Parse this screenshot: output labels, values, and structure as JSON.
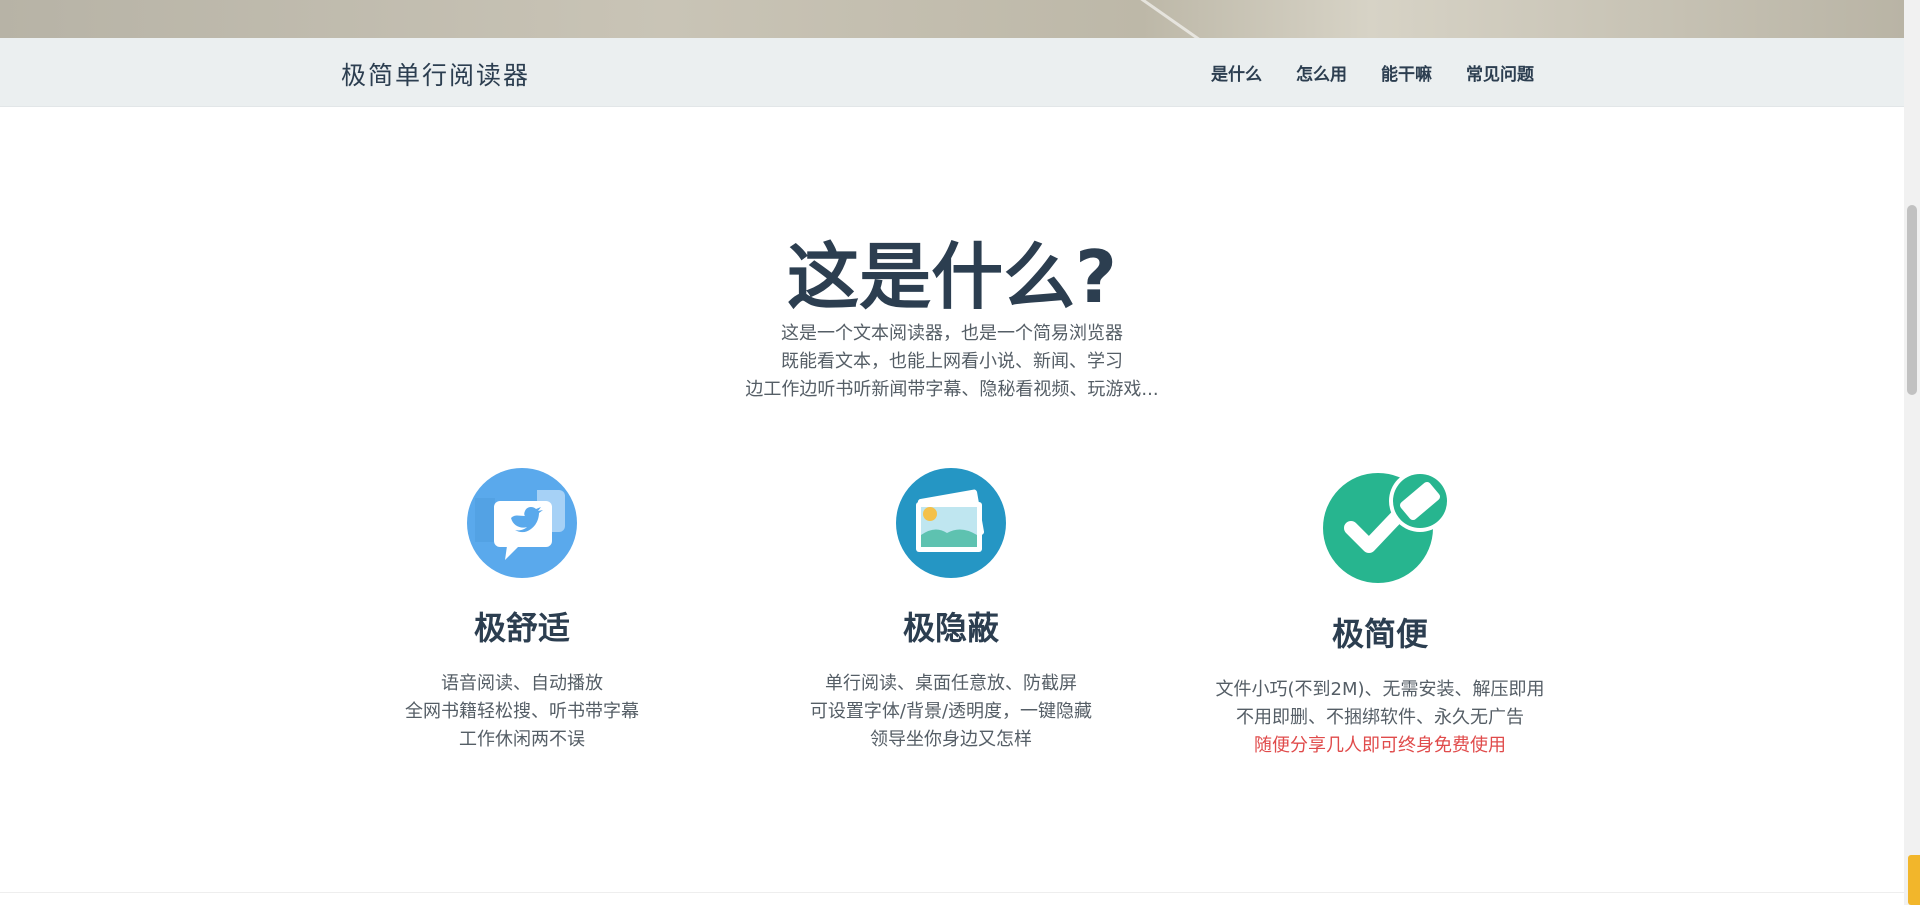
{
  "navbar": {
    "brand": "极简单行阅读器",
    "links": [
      "是什么",
      "怎么用",
      "能干嘛",
      "常见问题"
    ]
  },
  "intro": {
    "title": "这是什么?",
    "lines": [
      "这是一个文本阅读器，也是一个简易浏览器",
      "既能看文本，也能上网看小说、新闻、学习",
      "边工作边听书听新闻带字幕、隐秘看视频、玩游戏..."
    ]
  },
  "features": [
    {
      "icon": "chat-bird-icon",
      "title": "极舒适",
      "lines": [
        "语音阅读、自动播放",
        "全网书籍轻松搜、听书带字幕",
        "工作休闲两不误"
      ]
    },
    {
      "icon": "photos-icon",
      "title": "极隐蔽",
      "lines": [
        "单行阅读、桌面任意放、防截屏",
        "可设置字体/背景/透明度，一键隐藏",
        "领导坐你身边又怎样"
      ]
    },
    {
      "icon": "checkmark-eraser-icon",
      "title": "极简便",
      "lines": [
        "文件小巧(不到2M)、无需安装、解压即用",
        "不用即删、不捆绑软件、永久无广告"
      ],
      "highlight": "随便分享几人即可终身免费使用"
    }
  ],
  "colors": {
    "heading": "#2c3e50",
    "body_text": "#555e66",
    "accent_red": "#e04b4b",
    "navbar_bg": "#ebeff0",
    "icon_blue": "#5aa9ec",
    "icon_teal": "#2596c4",
    "icon_green": "#27b58f"
  }
}
